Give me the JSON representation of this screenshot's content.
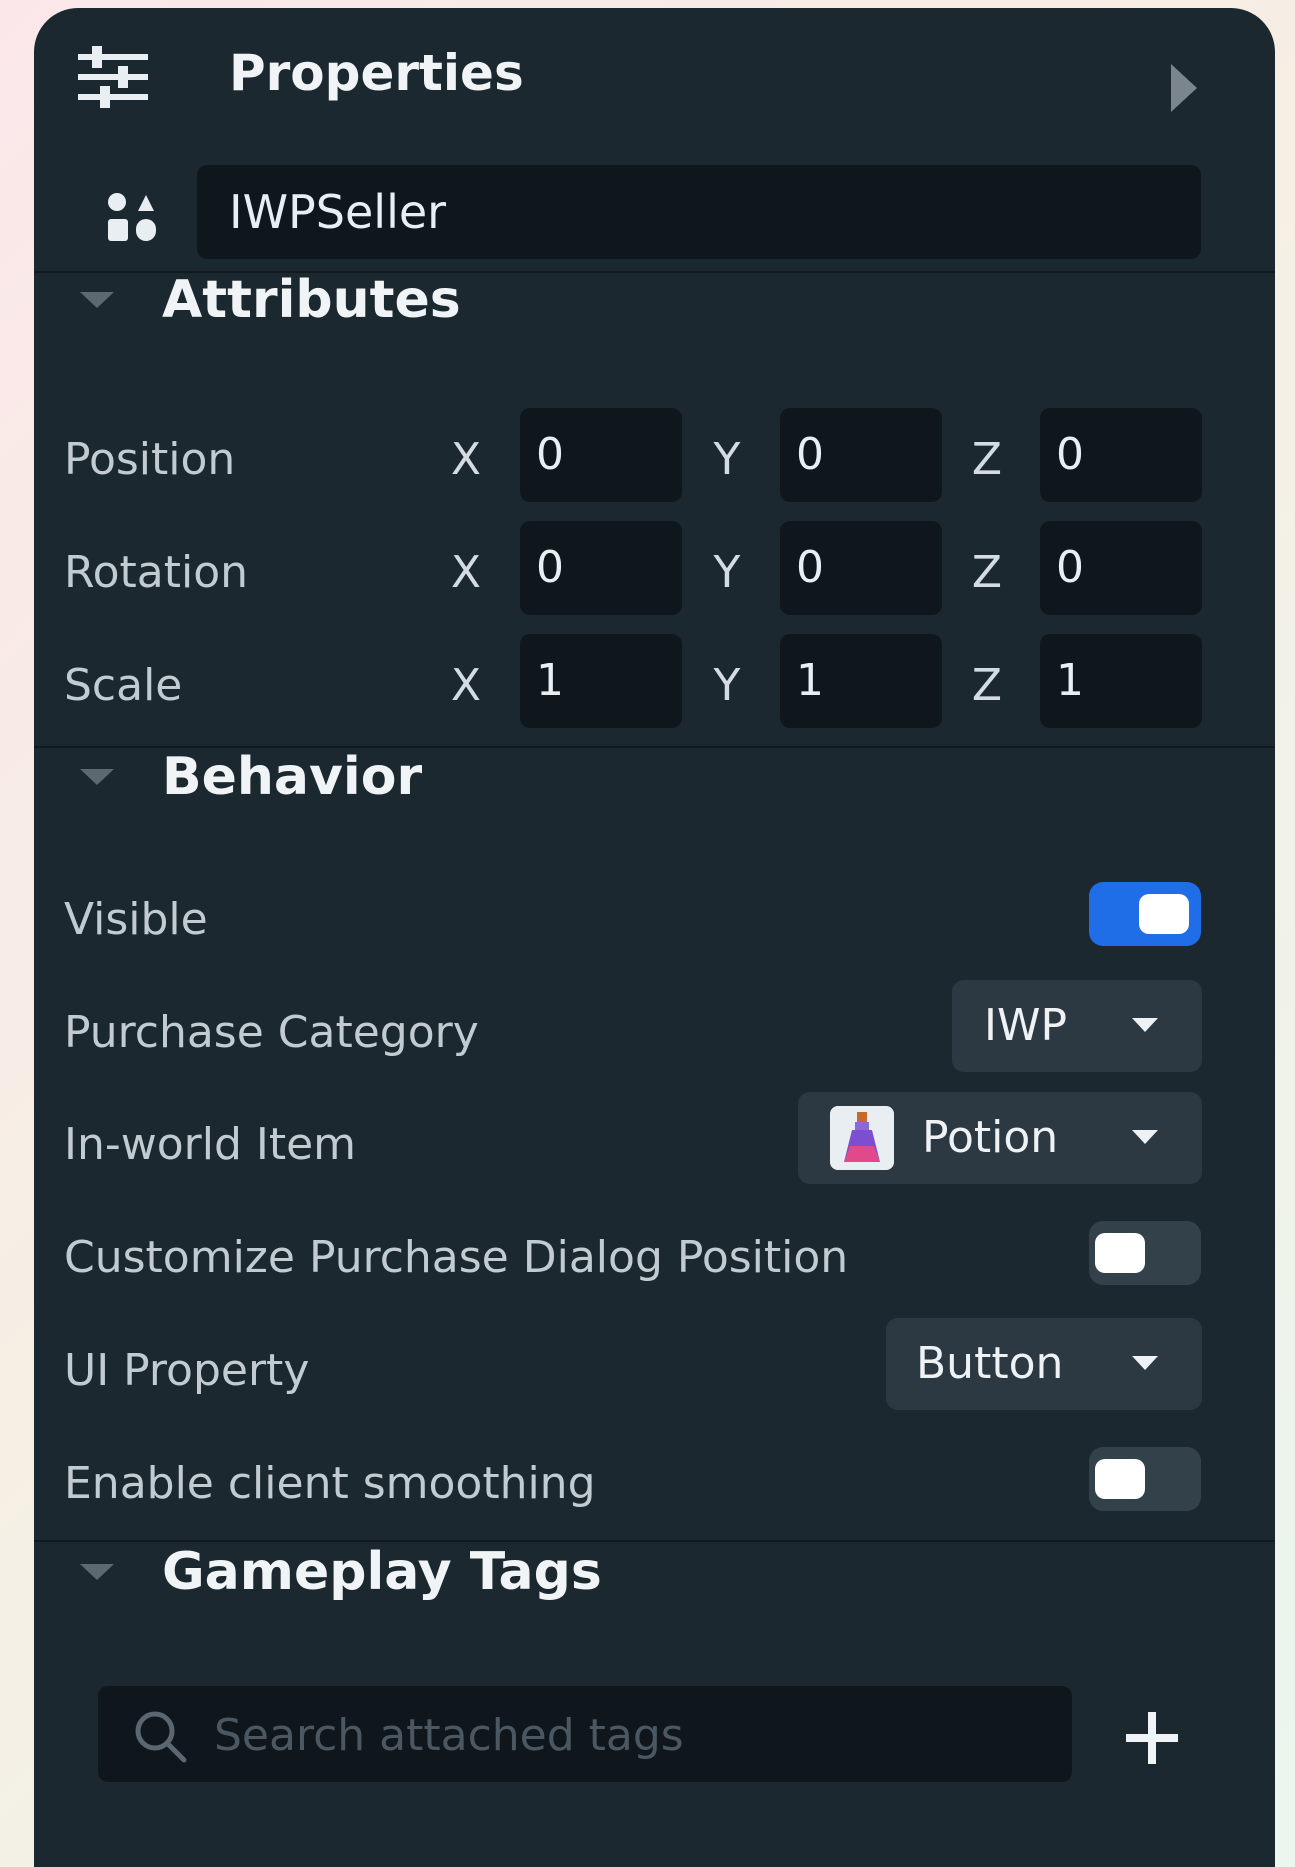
{
  "header": {
    "title": "Properties"
  },
  "object": {
    "name": "IWPSeller"
  },
  "attributes": {
    "title": "Attributes",
    "rows": [
      {
        "label": "Position",
        "x": "0",
        "y": "0",
        "z": "0"
      },
      {
        "label": "Rotation",
        "x": "0",
        "y": "0",
        "z": "0"
      },
      {
        "label": "Scale",
        "x": "1",
        "y": "1",
        "z": "1"
      }
    ],
    "axes": {
      "x": "X",
      "y": "Y",
      "z": "Z"
    }
  },
  "behavior": {
    "title": "Behavior",
    "visible": {
      "label": "Visible",
      "on": true
    },
    "purchase_category": {
      "label": "Purchase Category",
      "value": "IWP"
    },
    "in_world_item": {
      "label": "In-world Item",
      "value": "Potion",
      "icon": "potion-icon"
    },
    "customize_dialog": {
      "label": "Customize Purchase Dialog Position",
      "on": false
    },
    "ui_property": {
      "label": "UI Property",
      "value": "Button"
    },
    "client_smoothing": {
      "label": "Enable client smoothing",
      "on": false
    }
  },
  "gameplay_tags": {
    "title": "Gameplay Tags",
    "search_placeholder": "Search attached tags"
  },
  "colors": {
    "panel": "#1c2830",
    "input": "#10171c",
    "accent": "#1f6ee8",
    "dropdown": "#2c3942"
  }
}
